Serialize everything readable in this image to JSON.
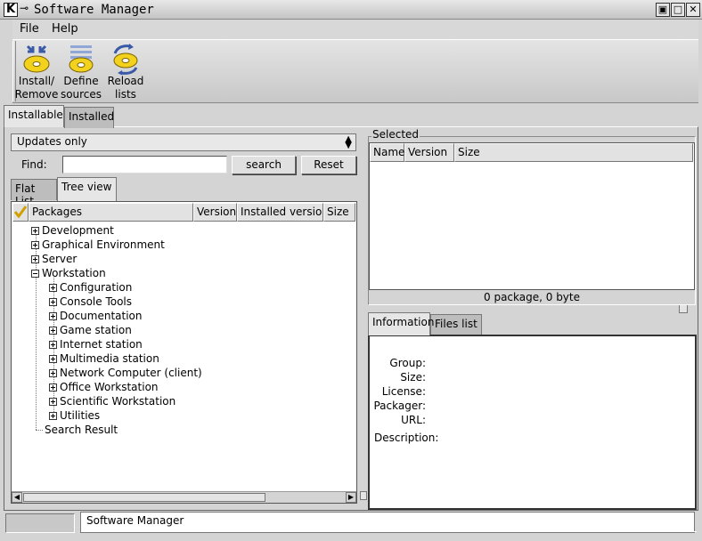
{
  "window": {
    "title": "Software Manager",
    "controls": {
      "minimize": "▣",
      "maximize": "□",
      "close": "✕"
    }
  },
  "menu": {
    "items": [
      "File",
      "Help"
    ]
  },
  "toolbar": {
    "install_remove": [
      "Install/",
      "Remove"
    ],
    "define_sources": [
      "Define",
      "sources"
    ],
    "reload_lists": [
      "Reload",
      "lists"
    ]
  },
  "main_tabs": {
    "installable": "Installable",
    "installed": "Installed",
    "active": "Installable"
  },
  "filter": {
    "selected": "Updates only"
  },
  "find": {
    "label": "Find:",
    "value": "",
    "search_button": "search",
    "reset_button": "Reset"
  },
  "view_tabs": {
    "flat": "Flat List",
    "tree": "Tree view",
    "active": "Tree view"
  },
  "tree": {
    "columns": [
      "Packages",
      "Version",
      "Installed version",
      "Size"
    ],
    "top_level": [
      "Development",
      "Graphical Environment",
      "Server",
      "Workstation"
    ],
    "workstation_children": [
      "Configuration",
      "Console Tools",
      "Documentation",
      "Game station",
      "Internet station",
      "Multimedia station",
      "Network Computer (client)",
      "Office Workstation",
      "Scientific Workstation",
      "Utilities"
    ],
    "search_result": "Search Result"
  },
  "selected": {
    "legend": "Selected",
    "columns": [
      "Name",
      "Version",
      "Size"
    ],
    "summary": "0 package, 0 byte"
  },
  "info_tabs": {
    "information": "Information",
    "files": "Files list",
    "active": "Information"
  },
  "info": {
    "labels": [
      "Group:",
      "Size:",
      "License:",
      "Packager:",
      "URL:"
    ],
    "description_label": "Description:"
  },
  "statusbar": {
    "text": "Software Manager"
  },
  "colors": {
    "disk_yellow": "#f2d21c",
    "arrow_blue": "#3a5aa8"
  }
}
